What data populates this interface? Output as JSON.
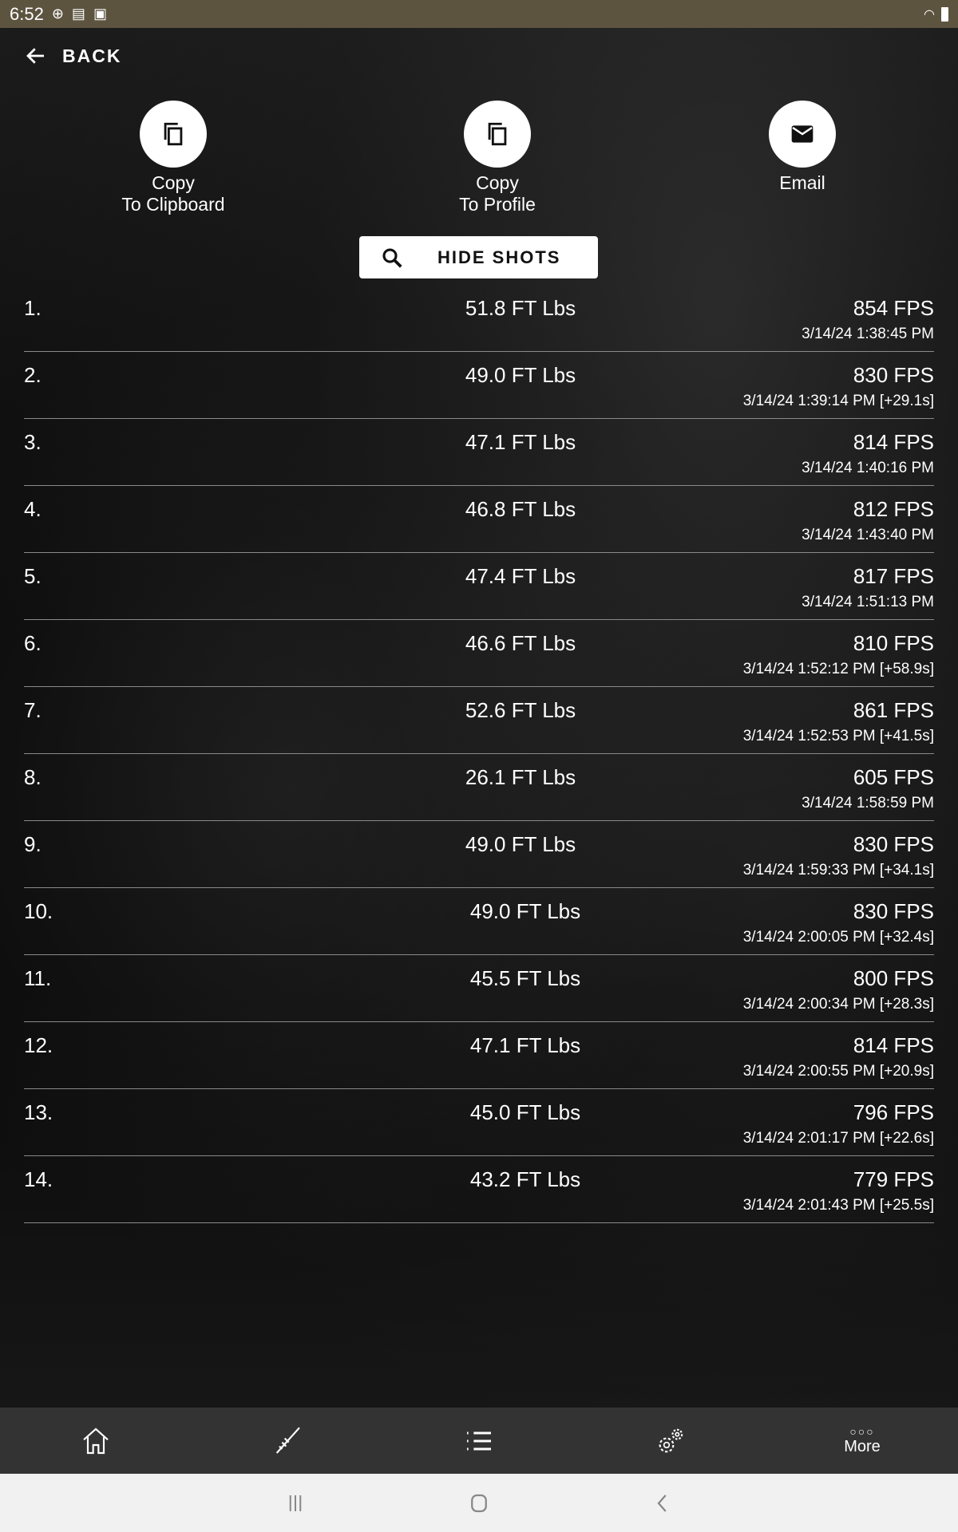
{
  "status_bar": {
    "time": "6:52"
  },
  "header": {
    "back_label": "BACK"
  },
  "actions": [
    {
      "line1": "Copy",
      "line2": "To Clipboard",
      "icon": "copy-icon"
    },
    {
      "line1": "Copy",
      "line2": "To Profile",
      "icon": "copy-icon"
    },
    {
      "line1": "Email",
      "line2": "",
      "icon": "mail-icon"
    }
  ],
  "hide_shots_label": "HIDE SHOTS",
  "shots": [
    {
      "num": "1.",
      "energy": "51.8 FT Lbs",
      "fps": "854 FPS",
      "time": "3/14/24 1:38:45 PM"
    },
    {
      "num": "2.",
      "energy": "49.0 FT Lbs",
      "fps": "830 FPS",
      "time": "3/14/24 1:39:14 PM [+29.1s]"
    },
    {
      "num": "3.",
      "energy": "47.1 FT Lbs",
      "fps": "814 FPS",
      "time": "3/14/24 1:40:16 PM"
    },
    {
      "num": "4.",
      "energy": "46.8 FT Lbs",
      "fps": "812 FPS",
      "time": "3/14/24 1:43:40 PM"
    },
    {
      "num": "5.",
      "energy": "47.4 FT Lbs",
      "fps": "817 FPS",
      "time": "3/14/24 1:51:13 PM"
    },
    {
      "num": "6.",
      "energy": "46.6 FT Lbs",
      "fps": "810 FPS",
      "time": "3/14/24 1:52:12 PM [+58.9s]"
    },
    {
      "num": "7.",
      "energy": "52.6 FT Lbs",
      "fps": "861 FPS",
      "time": "3/14/24 1:52:53 PM [+41.5s]"
    },
    {
      "num": "8.",
      "energy": "26.1 FT Lbs",
      "fps": "605 FPS",
      "time": "3/14/24 1:58:59 PM"
    },
    {
      "num": "9.",
      "energy": "49.0 FT Lbs",
      "fps": "830 FPS",
      "time": "3/14/24 1:59:33 PM [+34.1s]"
    },
    {
      "num": "10.",
      "energy": "49.0 FT Lbs",
      "fps": "830 FPS",
      "time": "3/14/24 2:00:05 PM [+32.4s]"
    },
    {
      "num": "11.",
      "energy": "45.5 FT Lbs",
      "fps": "800 FPS",
      "time": "3/14/24 2:00:34 PM [+28.3s]"
    },
    {
      "num": "12.",
      "energy": "47.1 FT Lbs",
      "fps": "814 FPS",
      "time": "3/14/24 2:00:55 PM [+20.9s]"
    },
    {
      "num": "13.",
      "energy": "45.0 FT Lbs",
      "fps": "796 FPS",
      "time": "3/14/24 2:01:17 PM [+22.6s]"
    },
    {
      "num": "14.",
      "energy": "43.2 FT Lbs",
      "fps": "779 FPS",
      "time": "3/14/24 2:01:43 PM [+25.5s]"
    }
  ],
  "bottom_nav": {
    "items": [
      "home-icon",
      "rifle-icon",
      "list-icon",
      "settings-icon"
    ],
    "more_label": "More"
  },
  "colors": {
    "status_bar": "#5d5440",
    "nav": "#333333",
    "system_nav": "#f1f1f1"
  }
}
